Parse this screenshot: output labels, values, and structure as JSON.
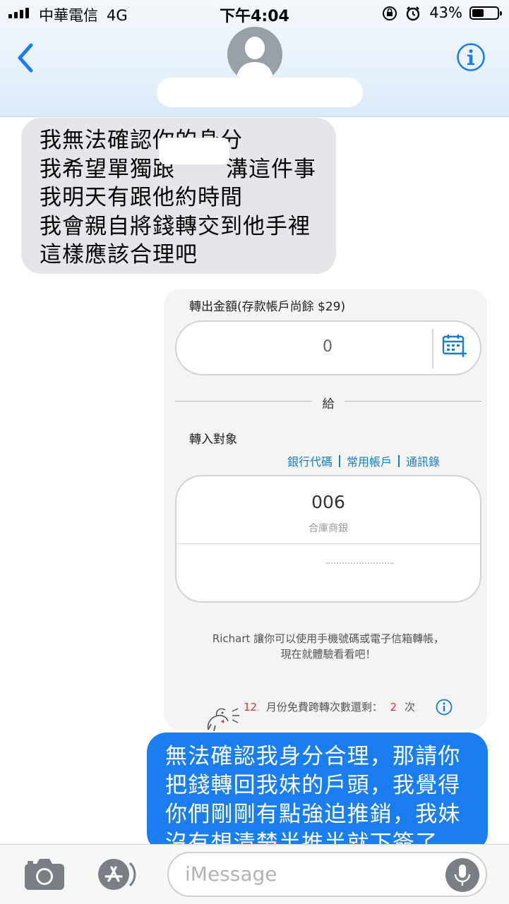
{
  "status_bar": {
    "carrier": "中華電信",
    "network": "4G",
    "time": "下午4:04",
    "battery": "43%"
  },
  "header": {
    "back_icon": "chevron-left-icon",
    "avatar_icon": "person-icon",
    "info_icon": "info-icon"
  },
  "messages": [
    {
      "direction": "incoming",
      "lines": [
        "我無法確認你的身分",
        "我希望單獨跟",
        "溝這件事",
        "我明天有跟他約時間",
        "我會親自將錢轉交到他手裡",
        "這樣應該合理吧"
      ]
    },
    {
      "direction": "outgoing",
      "lines": [
        "無法確認我身分合理，那請你",
        "把錢轉回我妹的戶頭，我覺得",
        "你們剛剛有點強迫推銷，我妹",
        "沒有想清楚半推半就下簽了。"
      ]
    }
  ],
  "transfer_card": {
    "amount_label": "轉出金額(存款帳戶尚餘 $29)",
    "amount_value": "0",
    "to_word": "給",
    "recipient_label": "轉入對象",
    "links": [
      "銀行代碼",
      "常用帳戶",
      "通訊錄"
    ],
    "bank_code": "006",
    "bank_name": "合庫商銀",
    "promo_line1": "Richart 讓你可以使用手機號碼或電子信箱轉帳，",
    "promo_line2": "現在就體驗看看吧！",
    "quota_month": "12",
    "quota_text": "月份免費跨轉次數還剩：",
    "quota_count": "2",
    "quota_unit": "次"
  },
  "composer": {
    "placeholder": "iMessage",
    "camera_icon": "camera-icon",
    "apps_icon": "app-store-icon",
    "mic_icon": "microphone-icon"
  },
  "colors": {
    "incoming_bubble": "#e5e5ea",
    "outgoing_bubble": "#1a7ef0",
    "link_blue": "#1d7dc4",
    "accent_red": "#d33333"
  }
}
